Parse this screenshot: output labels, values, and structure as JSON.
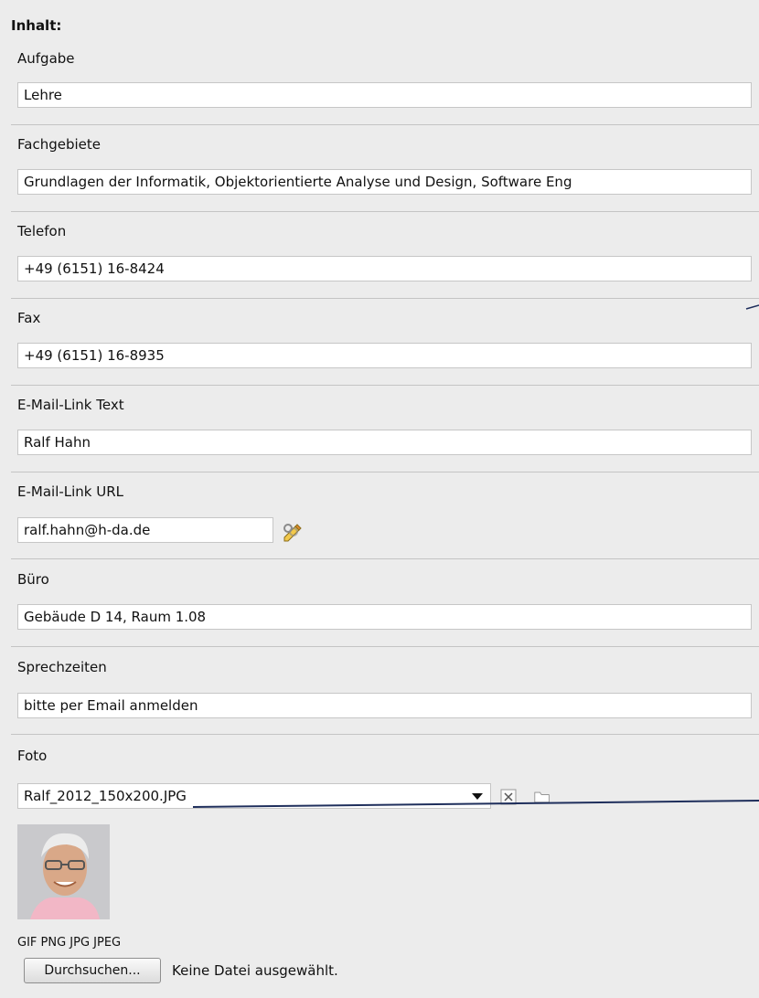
{
  "section_title": "Inhalt:",
  "fields": [
    {
      "label": "Aufgabe",
      "value": "Lehre"
    },
    {
      "label": "Fachgebiete",
      "value": "Grundlagen der Informatik, Objektorientierte Analyse und Design, Software Eng"
    },
    {
      "label": "Telefon",
      "value": "+49 (6151) 16-8424"
    },
    {
      "label": "Fax",
      "value": "+49 (6151) 16-8935"
    },
    {
      "label": "E-Mail-Link Text",
      "value": "Ralf Hahn"
    },
    {
      "label": "E-Mail-Link URL",
      "value": "ralf.hahn@h-da.de"
    },
    {
      "label": "Büro",
      "value": "Gebäude  D 14, Raum   1.08"
    },
    {
      "label": "Sprechzeiten",
      "value": "bitte per Email anmelden"
    }
  ],
  "photo": {
    "label": "Foto",
    "selected_file": "Ralf_2012_150x200.JPG",
    "allowed_types": "GIF PNG JPG JPEG",
    "browse_label": "Durchsuchen...",
    "no_file_text": "Keine Datei ausgewählt."
  },
  "icons": [
    "link-wizard-icon",
    "chevron-down-icon",
    "remove-icon",
    "folder-icon"
  ],
  "colors": {
    "background": "#ececec",
    "separator": "#c4c4c4",
    "field_border": "#c6c6c6",
    "annotation_line": "#1f2f5c"
  }
}
